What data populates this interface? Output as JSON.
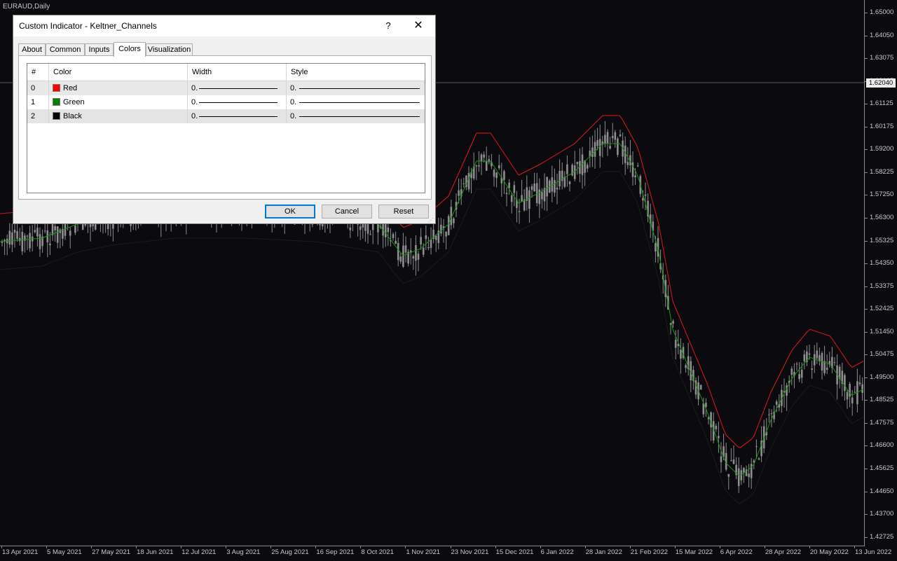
{
  "chart": {
    "symbol_label": "EURAUD,Daily",
    "current_price": "1.62040",
    "price_ticks": [
      "1.65000",
      "1.64050",
      "1.63075",
      "1.62125",
      "1.61125",
      "1.60175",
      "1.59200",
      "1.58225",
      "1.57250",
      "1.56300",
      "1.55325",
      "1.54350",
      "1.53375",
      "1.52425",
      "1.51450",
      "1.50475",
      "1.49500",
      "1.48525",
      "1.47575",
      "1.46600",
      "1.45625",
      "1.44650",
      "1.43700",
      "1.42725"
    ],
    "time_ticks": [
      "13 Apr 2021",
      "5 May 2021",
      "27 May 2021",
      "18 Jun 2021",
      "12 Jul 2021",
      "3 Aug 2021",
      "25 Aug 2021",
      "16 Sep 2021",
      "8 Oct 2021",
      "1 Nov 2021",
      "23 Nov 2021",
      "15 Dec 2021",
      "6 Jan 2022",
      "28 Jan 2022",
      "21 Feb 2022",
      "15 Mar 2022",
      "6 Apr 2022",
      "28 Apr 2022",
      "20 May 2022",
      "13 Jun 2022"
    ],
    "colors": {
      "background": "#0b0b0f",
      "candle": "#8e8e8e",
      "upper": "#e01818",
      "middle": "#149614",
      "lower": "#050505"
    }
  },
  "dialog": {
    "title": "Custom Indicator - Keltner_Channels",
    "help_label": "?",
    "close_label": "✕",
    "tabs": [
      {
        "label": "About"
      },
      {
        "label": "Common"
      },
      {
        "label": "Inputs"
      },
      {
        "label": "Colors"
      },
      {
        "label": "Visualization"
      }
    ],
    "active_tab": "Colors",
    "columns": {
      "index": "#",
      "color": "Color",
      "width": "Width",
      "style": "Style"
    },
    "rows": [
      {
        "index": "0",
        "color_name": "Red",
        "color_hex": "#ff0000",
        "width": "0.",
        "style": "0."
      },
      {
        "index": "1",
        "color_name": "Green",
        "color_hex": "#008000",
        "width": "0.",
        "style": "0."
      },
      {
        "index": "2",
        "color_name": "Black",
        "color_hex": "#000000",
        "width": "0.",
        "style": "0."
      }
    ],
    "buttons": {
      "ok": "OK",
      "cancel": "Cancel",
      "reset": "Reset"
    }
  }
}
